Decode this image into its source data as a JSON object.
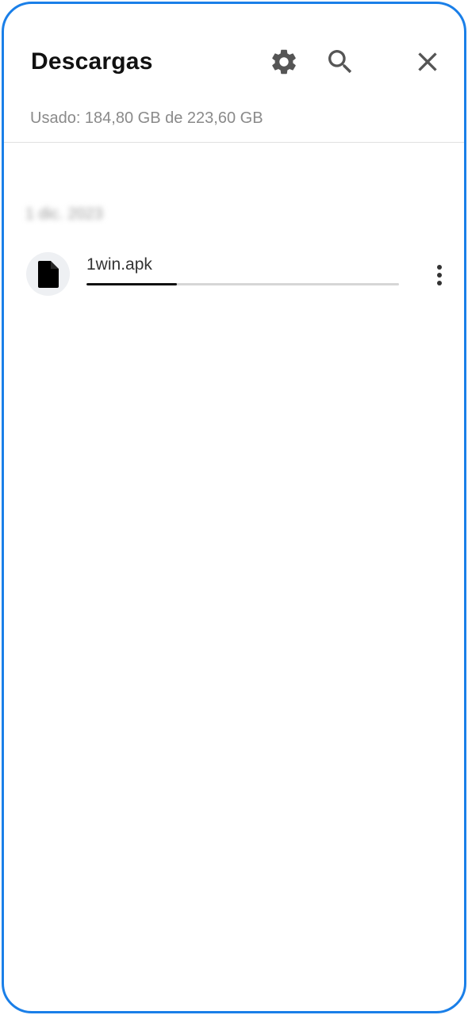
{
  "header": {
    "title": "Descargas",
    "storage_text": "Usado: 184,80 GB de 223,60 GB",
    "icons": [
      "gear-icon",
      "search-icon",
      "close-icon"
    ]
  },
  "list": {
    "date_header": "1 dic. 2023",
    "items": [
      {
        "file_name": "1win.apk",
        "icon": "file-icon",
        "progress": 0.29
      }
    ]
  },
  "colors": {
    "frame_border": "#1a7fe8",
    "icon": "#555555",
    "progress_fill": "#111111",
    "progress_track": "#d6d6d6"
  }
}
